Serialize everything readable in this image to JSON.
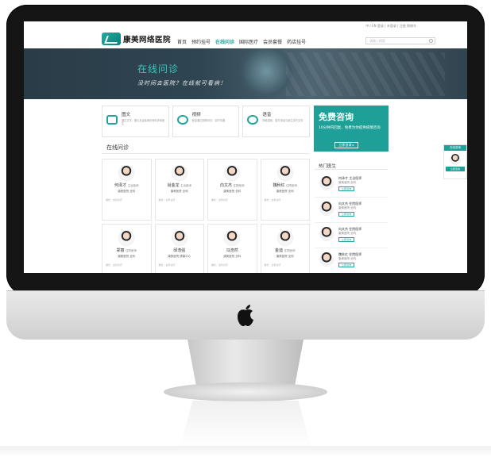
{
  "site": {
    "logo_text": "康美网络医院",
    "top_links": "中 / EN   登录 | 未登录 | 注册   购物车",
    "nav": [
      "首页",
      "预约挂号",
      "在线问诊",
      "国际医疗",
      "会员套餐",
      "药店挂号"
    ],
    "active_nav": "在线问诊",
    "search_placeholder": "请输入搜索"
  },
  "banner": {
    "title": "在线问诊",
    "subtitle": "没时间去医院？在线就可看病！"
  },
  "services": [
    {
      "name": "图文",
      "desc": "通过文字、图片及患者病历资料咨询医生",
      "icon": "image-icon"
    },
    {
      "name": "视频",
      "desc": "医患通过视频问诊，实时沟通",
      "icon": "video-icon"
    },
    {
      "name": "语音",
      "desc": "网络语音，拨打电话与医生实时交流",
      "icon": "phone-icon"
    }
  ],
  "free_consult": {
    "title": "免费咨询",
    "desc": "10分钟内回复，免费为你提供病情咨询",
    "button": "立即咨询 ▸"
  },
  "section": {
    "title": "在线问诊"
  },
  "doctors": [
    {
      "name": "何泽才",
      "title": "主治医师",
      "dept": "康美医院 全科",
      "intro": "擅长：全科诊疗"
    },
    {
      "name": "肖金龙",
      "title": "主治医师",
      "dept": "康美医院 全科",
      "intro": "擅长：全科诊疗"
    },
    {
      "name": "向文杰",
      "title": "住院医师",
      "dept": "康美医院 全科",
      "intro": "擅长：全科诊疗"
    },
    {
      "name": "魏秋红",
      "title": "住院医师",
      "dept": "康美医院 全科",
      "intro": "擅长：全科诊疗"
    },
    {
      "name": "郑丽",
      "title": "住院医师",
      "dept": "康美医院 全科",
      "intro": "擅长：全科诊疗"
    },
    {
      "name": "邱浩强",
      "title": "",
      "dept": "康美医院 健康中心",
      "intro": "擅长：全科诊疗"
    },
    {
      "name": "冯浩然",
      "title": "",
      "dept": "康美医院 全科",
      "intro": "擅长：全科诊疗"
    },
    {
      "name": "金迪",
      "title": "住院医师",
      "dept": "康美医院 全科",
      "intro": "擅长：全科诊疗"
    }
  ],
  "hot": {
    "title": "热门医生",
    "items": [
      {
        "name": "何泽才 主治医师",
        "dept": "康美医院 全科",
        "button": "立即咨询"
      },
      {
        "name": "向文杰 住院医师",
        "dept": "康美医院 全科",
        "button": "立即咨询"
      },
      {
        "name": "向文杰 住院医师",
        "dept": "康美医院 全科",
        "button": "立即咨询"
      },
      {
        "name": "魏秋红 住院医师",
        "dept": "康美医院 全科",
        "button": "立即咨询"
      }
    ]
  },
  "float_panel": {
    "header": "在线咨询",
    "button": "立即咨询"
  },
  "colors": {
    "accent": "#22a39c",
    "banner": "#2f4552",
    "bezel": "#151515"
  }
}
